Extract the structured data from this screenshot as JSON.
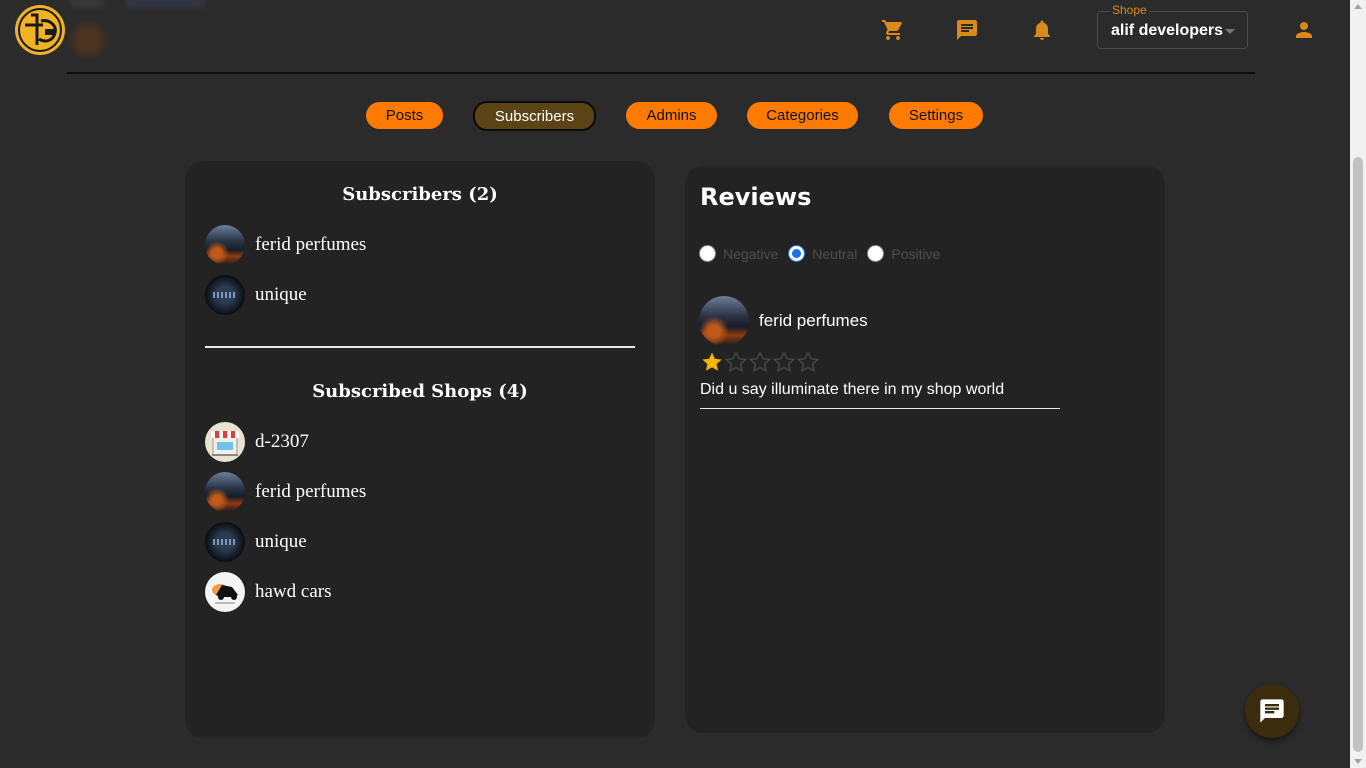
{
  "header": {
    "shop_select": {
      "label": "Shope",
      "value": "alif developers"
    }
  },
  "tabs": [
    {
      "label": "Posts"
    },
    {
      "label": "Subscribers",
      "active": true
    },
    {
      "label": "Admins"
    },
    {
      "label": "Categories"
    },
    {
      "label": "Settings"
    }
  ],
  "subscribers": {
    "title": "Subscribers (2)",
    "items": [
      {
        "name": "ferid perfumes",
        "avatar": "city-night-avatar"
      },
      {
        "name": "unique",
        "avatar": "dark-logo-avatar"
      }
    ]
  },
  "subscribed_shops": {
    "title": "Subscribed Shops (4)",
    "items": [
      {
        "name": "d-2307",
        "avatar": "shop-front-avatar"
      },
      {
        "name": "ferid perfumes",
        "avatar": "city-night-avatar"
      },
      {
        "name": "unique",
        "avatar": "dark-logo-avatar"
      },
      {
        "name": "hawd cars",
        "avatar": "car-logo-avatar"
      }
    ]
  },
  "reviews": {
    "title": "Reviews",
    "filters": [
      {
        "label": "Negative",
        "selected": false
      },
      {
        "label": "Neutral",
        "selected": true
      },
      {
        "label": "Positive",
        "selected": false
      }
    ],
    "items": [
      {
        "author": "ferid perfumes",
        "rating": 1,
        "max_rating": 5,
        "text": "Did u say illuminate there in my shop world"
      }
    ]
  },
  "colors": {
    "accent": "#ff7b00",
    "active_tab": "#5b4315",
    "background": "#2b2b2b",
    "panel": "#232323",
    "star": "#f5b400",
    "logo": "#f0b323"
  },
  "icons": [
    "cart-icon",
    "chat-icon",
    "bell-icon",
    "user-icon",
    "chat-fab-icon",
    "star-icon"
  ]
}
